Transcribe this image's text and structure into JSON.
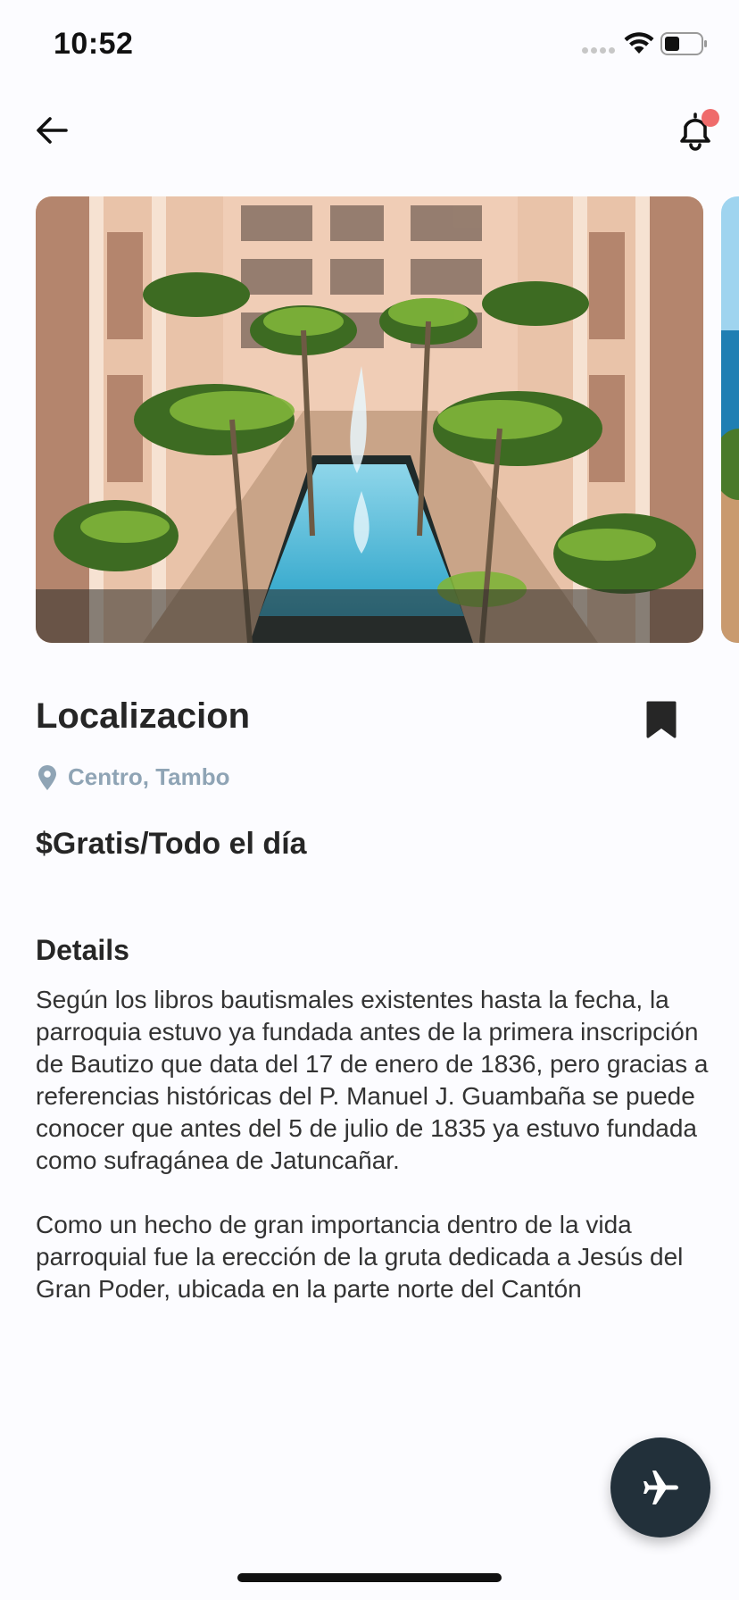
{
  "status_bar": {
    "time": "10:52",
    "icons": [
      "signal-dots-icon",
      "wifi-icon",
      "battery-icon"
    ]
  },
  "header": {
    "back_icon": "arrow-left-icon",
    "notification_icon": "bell-icon",
    "notification_dot_color": "#ef6b6b"
  },
  "gallery": {
    "images": [
      "resort-courtyard-pool-photo",
      "ocean-view-photo"
    ]
  },
  "place": {
    "title": "Localizacion",
    "location": "Centro, Tambo",
    "price": "$Gratis/Todo el día",
    "bookmark_icon": "bookmark-icon"
  },
  "details": {
    "heading": "Details",
    "paragraphs": [
      "Según los libros bautismales existentes hasta la fecha, la parroquia estuvo ya fundada antes de la primera inscripción de Bautizo que data del 17 de enero de 1836, pero gracias a referencias históricas del P. Manuel J. Guambaña se puede conocer que antes del 5 de julio de 1835 ya estuvo fundada como sufragánea de Jatuncañar.",
      "Como un hecho de gran importancia dentro de la vida parroquial fue la erección de la gruta dedicada a Jesús del Gran Poder, ubicada en la parte norte del Cantón"
    ]
  },
  "fab": {
    "icon": "airplane-icon",
    "color": "#22303a"
  },
  "colors": {
    "background": "#fcfcff",
    "muted_text": "#8fa4b5",
    "dark": "#262626"
  }
}
